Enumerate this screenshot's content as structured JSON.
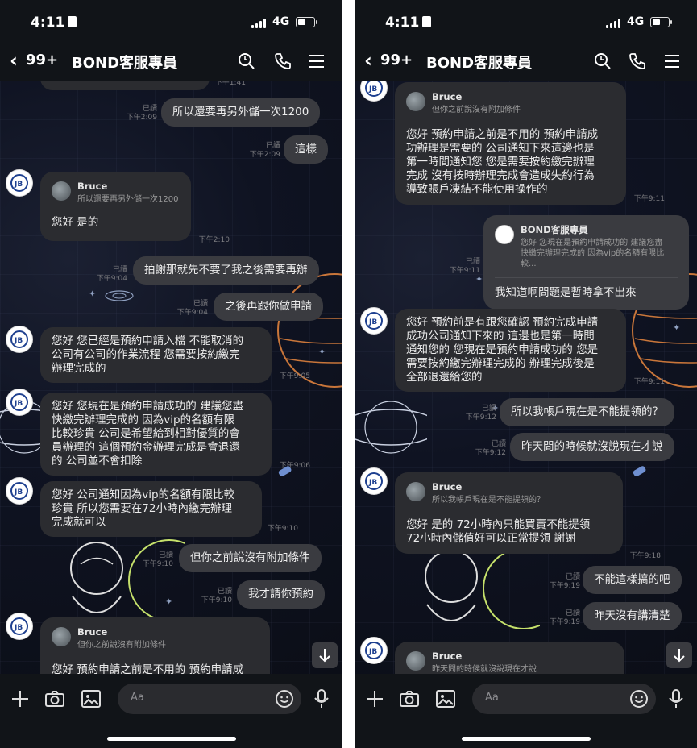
{
  "colors": {
    "background": "#0f1115",
    "bubble_in": "#2b2c30",
    "bubble_out": "#3a3b40",
    "meta": "#7c7c80"
  },
  "status": {
    "time": "4:11",
    "network": "4G"
  },
  "header": {
    "unread_count": "99+",
    "title": "BOND客服專員"
  },
  "input": {
    "placeholder": "Aa"
  },
  "icons": [
    "back-icon",
    "search-icon",
    "phone-icon",
    "menu-icon",
    "plus-icon",
    "camera-icon",
    "image-icon",
    "emoji-icon",
    "mic-icon",
    "arrow-down-icon"
  ],
  "left": {
    "meta1": {
      "time": "下午1:41"
    },
    "msg1": {
      "text": "所以還要再另外儲一次1200",
      "read": "已讀",
      "time": "下午2:09"
    },
    "msg2": {
      "text": "這樣",
      "read": "已讀",
      "time": "下午2:09"
    },
    "msg3": {
      "quote_name": "Bruce",
      "quote_text": "所以還要再另外儲一次1200",
      "text": "您好 是的",
      "time": "下午2:10"
    },
    "msg4": {
      "text": "拍謝那就先不要了我之後需要再辦",
      "read": "已讀",
      "time": "下午9:04"
    },
    "msg5": {
      "text": "之後再跟你做申請",
      "read": "已讀",
      "time": "下午9:04"
    },
    "msg6": {
      "text": "您好 您已經是預約申請入檔 不能取消的\n公司有公司的作業流程 您需要按約繳完\n辦理完成的",
      "time": "下午9:05"
    },
    "msg7": {
      "text": "您好 您現在是預約申請成功的 建議您盡\n快繳完辦理完成的 因為vip的名額有限\n比較珍貴 公司是希望給到相對優質的會\n員辦理的 這個預約金辦理完成是會退還\n的 公司並不會扣除",
      "time": "下午9:06"
    },
    "msg8": {
      "text": "您好 公司通知因為vip的名額有限比較\n珍貴 所以您需要在72小時內繳完辦理\n完成就可以",
      "time": "下午9:10"
    },
    "msg9": {
      "text": "但你之前說沒有附加條件",
      "read": "已讀",
      "time": "下午9:10"
    },
    "msg10": {
      "text": "我才請你預約",
      "read": "已讀",
      "time": "下午9:10"
    },
    "msg11": {
      "quote_name": "Bruce",
      "quote_text": "但你之前說沒有附加條件",
      "text": "您好 預約申請之前是不用的 預約申請成"
    }
  },
  "right": {
    "msg1": {
      "quote_name": "Bruce",
      "quote_text": "但你之前說沒有附加條件",
      "text": "您好 預約申請之前是不用的 預約申請成\n功辦理是需要的 公司通知下來這邊也是\n第一時間通知您 您是需要按約繳完辦理\n完成 沒有按時辦理完成會造成失約行為\n導致賬戶凍結不能使用操作的",
      "time": "下午9:11"
    },
    "msg2": {
      "quote_name": "BOND客服專員",
      "quote_text": "您好 您現在是預約申請成功的 建議您盡\n快繳完辦理完成的 因為vip的名額有限比較...",
      "text": "我知道啊問題是暫時拿不出來",
      "read": "已讀",
      "time": "下午9:11"
    },
    "msg3": {
      "text": "您好 預約前是有跟您確認 預約完成申請\n成功公司通知下來的 這邊也是第一時間\n通知您的 您現在是預約申請成功的 您是\n需要按約繳完辦理完成的 辦理完成後是\n全部退還給您的",
      "time": "下午9:11"
    },
    "msg4": {
      "text": "所以我帳戶現在是不能提領的？",
      "read": "已讀",
      "time": "下午9:12"
    },
    "msg5": {
      "text": "昨天問的時候就沒說現在才說",
      "read": "已讀",
      "time": "下午9:12"
    },
    "msg6": {
      "quote_name": "Bruce",
      "quote_text": "所以我帳戶現在是不能提領的？",
      "text": "您好 是的 72小時內只能買賣不能提領\n72小時內儲值好可以正常提領 謝謝",
      "time": "下午9:18"
    },
    "msg7": {
      "text": "不能這樣搞的吧",
      "read": "已讀",
      "time": "下午9:19"
    },
    "msg8": {
      "text": "昨天沒有講清楚",
      "read": "已讀",
      "time": "下午9:19"
    },
    "msg9": {
      "quote_name": "Bruce",
      "quote_text": "昨天問的時候就沒說現在才說"
    }
  }
}
